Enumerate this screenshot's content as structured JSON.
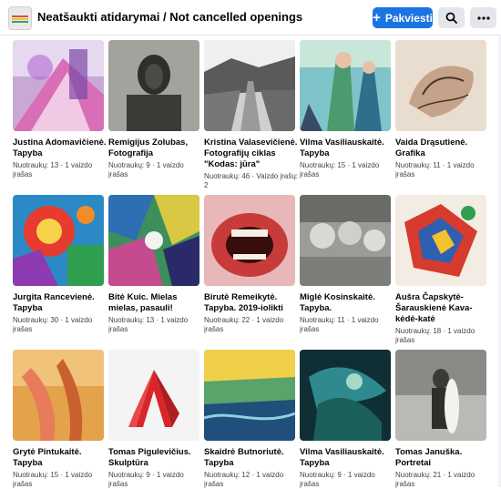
{
  "group": {
    "title": "Neatšaukti atidarymai / Not cancelled openings",
    "logo_icon": "group-logo-icon"
  },
  "toolbar": {
    "share_label": "Pakviesti",
    "share_icon": "plus-icon",
    "search_icon": "search-icon",
    "more_icon": "more-icon"
  },
  "albums": [
    {
      "title": "Justina Adomavičienė. Tapyba",
      "meta": "Nuotraukų: 13 · 1 vaizdo įrašas"
    },
    {
      "title": "Remigijus Zolubas, Fotografija",
      "meta": "Nuotraukų: 9 · 1 vaizdo įrašas"
    },
    {
      "title": "Kristina Valasevičienė. Fotografijų ciklas \"Kodas: jūra\"",
      "meta": "Nuotraukų: 46 · Vaizdo įrašų: 2"
    },
    {
      "title": "Vilma Vasiliauskaitė. Tapyba",
      "meta": "Nuotraukų: 15 · 1 vaizdo įrašas"
    },
    {
      "title": "Vaida Drąsutienė. Grafika",
      "meta": "Nuotraukų: 11 · 1 vaizdo įrašas"
    },
    {
      "title": "Jurgita Rancevienė. Tapyba",
      "meta": "Nuotraukų: 30 · 1 vaizdo įrašas"
    },
    {
      "title": "Bitė Kuic. Mielas mielas, pasauli!",
      "meta": "Nuotraukų: 13 · 1 vaizdo įrašas"
    },
    {
      "title": "Birutė Remeikytė. Tapyba. 2019-iolikti",
      "meta": "Nuotraukų: 22 · 1 vaizdo įrašas"
    },
    {
      "title": "Miglė Kosinskaitė. Tapyba.",
      "meta": "Nuotraukų: 11 · 1 vaizdo įrašas"
    },
    {
      "title": "Aušra Čapskytė-Šarauskienė Kava-kėdė-katė",
      "meta": "Nuotraukų: 18 · 1 vaizdo įrašas"
    },
    {
      "title": "Grytė Pintukaitė. Tapyba",
      "meta": "Nuotraukų: 15 · 1 vaizdo įrašas"
    },
    {
      "title": "Tomas Pigulevičius. Skulptūra",
      "meta": "Nuotraukų: 9 · 1 vaizdo įrašas"
    },
    {
      "title": "Skaidrė Butnoriutė. Tapyba",
      "meta": "Nuotraukų: 12 · 1 vaizdo įrašas"
    },
    {
      "title": "Vilma Vasiliauskaitė. Tapyba",
      "meta": "Nuotraukų: 9 · 1 vaizdo įrašas"
    },
    {
      "title": "Tomas Januška. Portretai",
      "meta": "Nuotraukų: 21 · 1 vaizdo įrašas"
    }
  ]
}
